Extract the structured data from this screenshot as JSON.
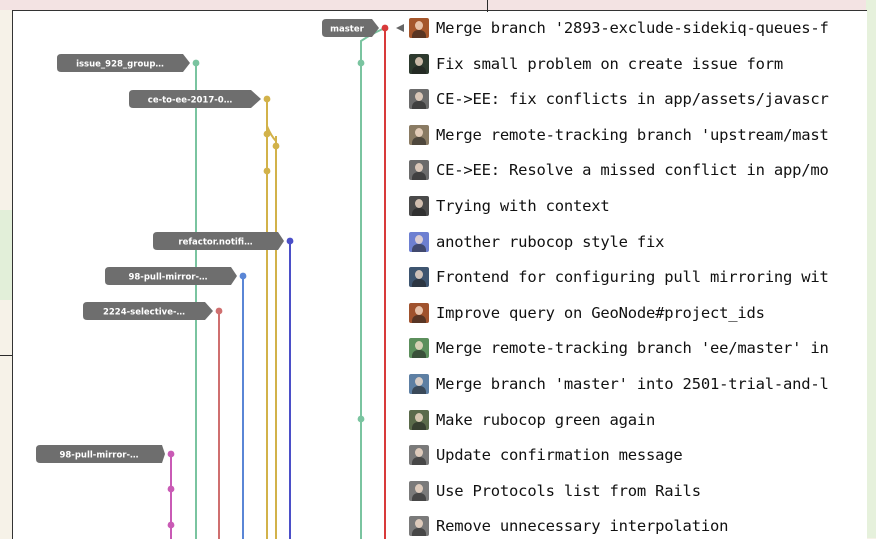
{
  "refs": [
    {
      "label": "master",
      "color": "#d83a3a"
    },
    {
      "label": "issue_928_group…",
      "color": "#7ac4a0"
    },
    {
      "label": "ce-to-ee-2017-0…",
      "color": "#d2b24a"
    },
    {
      "label": "refactor.notifi…",
      "color": "#4b4fc8"
    },
    {
      "label": "98-pull-mirror-…",
      "color": "#5a86d6"
    },
    {
      "label": "2224-selective-…",
      "color": "#cf6f6f"
    },
    {
      "label": "98-pull-mirror-…",
      "color": "#c95ab5"
    }
  ],
  "commits": [
    {
      "message": "Merge branch '2893-exclude-sidekiq-queues-f",
      "avatar": "#a5562b"
    },
    {
      "message": "Fix small problem on create issue form",
      "avatar": "#2d3a2e"
    },
    {
      "message": "CE->EE: fix conflicts in app/assets/javascr",
      "avatar": "#6b6b6b"
    },
    {
      "message": "Merge remote-tracking branch 'upstream/mast",
      "avatar": "#8a7b63"
    },
    {
      "message": "CE->EE: Resolve a missed conflict in app/mo",
      "avatar": "#6b6b6b"
    },
    {
      "message": "Trying with context",
      "avatar": "#4a4a4a"
    },
    {
      "message": "another rubocop style fix",
      "avatar": "#6d7fd1"
    },
    {
      "message": "Frontend for configuring pull mirroring wit",
      "avatar": "#3e5570"
    },
    {
      "message": "Improve query on GeoNode#project_ids",
      "avatar": "#a0522d"
    },
    {
      "message": "Merge remote-tracking branch 'ee/master' in",
      "avatar": "#5c8f5c"
    },
    {
      "message": "Merge branch 'master' into 2501-trial-and-l",
      "avatar": "#5d7fa3"
    },
    {
      "message": "Make rubocop green again",
      "avatar": "#5a6a4a"
    },
    {
      "message": "Update confirmation message",
      "avatar": "#7a7a7a"
    },
    {
      "message": "Use Protocols list from Rails",
      "avatar": "#7a7a7a"
    },
    {
      "message": "Remove unnecessary interpolation",
      "avatar": "#7a7a7a"
    }
  ]
}
